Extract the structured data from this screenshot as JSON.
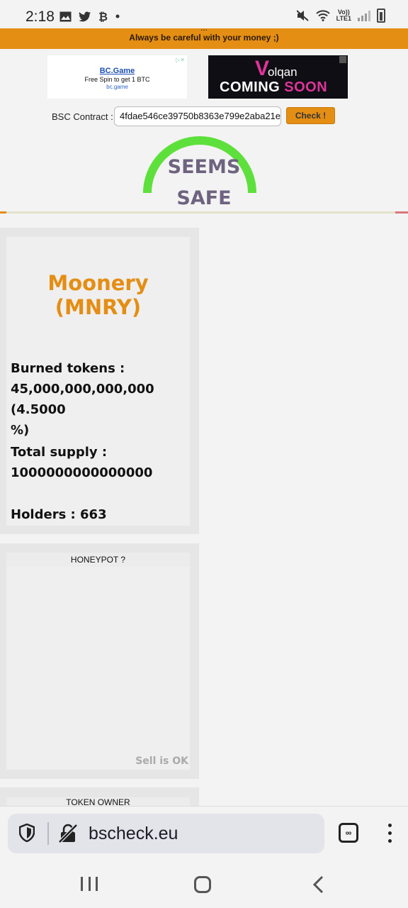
{
  "status_bar": {
    "time": "2:18",
    "left_icons": [
      "gallery-icon",
      "twitter-icon",
      "bitcoin-icon",
      "dot-icon"
    ],
    "right_icons": [
      "mute-icon",
      "wifi-icon",
      "lte-icon",
      "signal-icon",
      "battery-icon"
    ],
    "lte_top": "Vo))",
    "lte_bottom": "LTE1"
  },
  "banner": {
    "top_line": "...",
    "main_line": "Always be careful with your money ;)"
  },
  "ads": {
    "bcgame": {
      "title": "BC.Game",
      "subtitle": "Free Spin to get 1 BTC",
      "url": "bc.game"
    },
    "volqan": {
      "logo_letter": "V",
      "name": "olqan",
      "coming": "COMING ",
      "soon": "SOON"
    }
  },
  "contract": {
    "label": "BSC Contract :",
    "value": "4fdae546ce39750b8363e799e2aba21e",
    "button": "Check !"
  },
  "gauge": {
    "line1": "SEEMS",
    "line2": "SAFE",
    "color": "#5ee03c"
  },
  "token": {
    "name": "Moonery (MNRY)",
    "burned_label": "Burned tokens :",
    "burned_value": "45,000,000,000,000 (4.5000",
    "burned_tail": "%)",
    "supply_label": "Total supply :",
    "supply_value": "1000000000000000",
    "holders": "Holders : 663"
  },
  "honeypot": {
    "title": "HONEYPOT ?",
    "status": "Sell is OK"
  },
  "owner": {
    "title": "TOKEN OWNER"
  },
  "browser": {
    "url": "bscheck.eu",
    "tabs_glyph": "∞"
  },
  "colors": {
    "accent": "#e48e14",
    "gauge": "#5ee03c",
    "gauge_text": "#6e6380"
  }
}
